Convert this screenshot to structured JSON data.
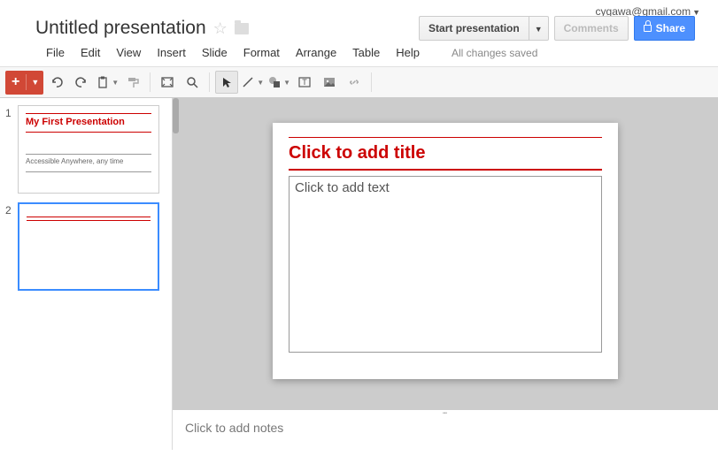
{
  "account": {
    "email": "cygawa@gmail.com"
  },
  "document": {
    "title": "Untitled presentation"
  },
  "actions": {
    "start_presentation": "Start presentation",
    "comments": "Comments",
    "share": "Share"
  },
  "menu": {
    "file": "File",
    "edit": "Edit",
    "view": "View",
    "insert": "Insert",
    "slide": "Slide",
    "format": "Format",
    "arrange": "Arrange",
    "table": "Table",
    "help": "Help",
    "save_status": "All changes saved"
  },
  "thumbnails": [
    {
      "num": "1",
      "title": "My First Presentation",
      "subtitle": "Accessible Anywhere, any time",
      "selected": false
    },
    {
      "num": "2",
      "title": "",
      "subtitle": "",
      "selected": true
    }
  ],
  "slide": {
    "title_placeholder": "Click to add title",
    "body_placeholder": "Click to add text"
  },
  "notes": {
    "placeholder": "Click to add notes"
  }
}
